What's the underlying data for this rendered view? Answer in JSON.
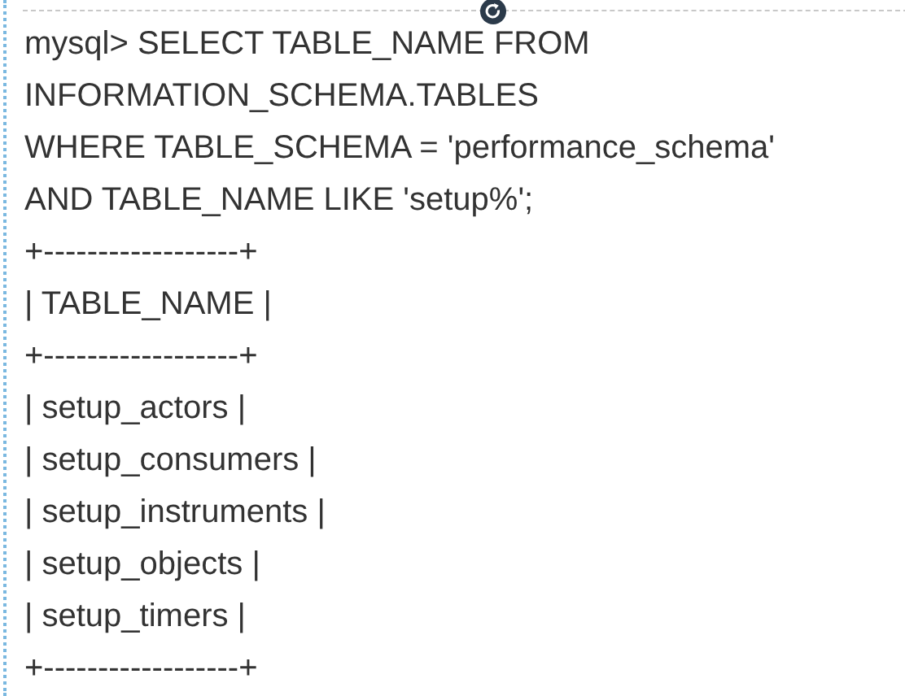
{
  "lines": [
    "mysql> SELECT TABLE_NAME FROM",
    "INFORMATION_SCHEMA.TABLES",
    "WHERE TABLE_SCHEMA = 'performance_schema'",
    "AND TABLE_NAME LIKE 'setup%';",
    "+------------------+",
    "| TABLE_NAME |",
    "+------------------+",
    "| setup_actors |",
    "| setup_consumers |",
    "| setup_instruments |",
    "| setup_objects |",
    "| setup_timers |",
    "+------------------+"
  ]
}
